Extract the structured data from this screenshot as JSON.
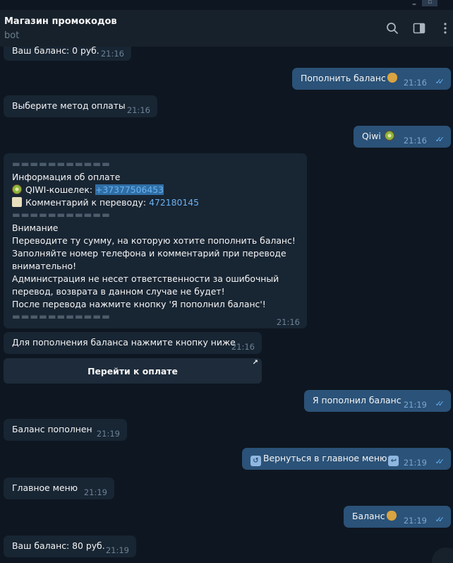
{
  "header": {
    "title": "Магазин промокодов",
    "subtitle": "bot",
    "icons": [
      "search-icon",
      "sidebar-toggle-icon",
      "more-icon"
    ]
  },
  "window": {
    "controls": [
      "minimize",
      "maximize",
      "close"
    ]
  },
  "messages": {
    "m1": {
      "text": "Ваш баланс: 0 руб.",
      "time": "21:16"
    },
    "m2": {
      "text": "Пополнить баланс",
      "time": "21:16",
      "emoji": "money-bag"
    },
    "m3": {
      "text": "Выберите метод оплаты",
      "time": "21:16"
    },
    "m4": {
      "text": "Qiwi",
      "time": "21:16",
      "emoji": "kiwi"
    },
    "m5": {
      "separator": "▬▬▬▬▬▬▬▬▬▬▬",
      "heading": "Информация об оплате",
      "wallet_label": "QIWI-кошелек:",
      "wallet_value": "+37377506453",
      "comment_label": "Комментарий к переводу:",
      "comment_value": "472180145",
      "attention": "Внимание",
      "line1": "Переводите ту сумму, на которую хотите пополнить баланс!",
      "line2": "Заполняйте номер телефона и комментарий при переводе",
      "line3": "внимательно!",
      "line4": "Администрация не несет ответственности за ошибочный",
      "line5": "перевод, возврата в данном случае не будет!",
      "line6": "После перевода нажмите кнопку 'Я пополнил баланс'!",
      "time": "21:16"
    },
    "m6": {
      "text": "Для пополнения баланса нажмите кнопку ниже",
      "time": "21:16"
    },
    "m6_button": "Перейти к оплате",
    "m7": {
      "text": "Я пополнил баланс",
      "time": "21:19"
    },
    "m8": {
      "text": "Баланс пополнен",
      "time": "21:19"
    },
    "m9": {
      "text": "Вернуться в главное меню",
      "time": "21:19"
    },
    "m10": {
      "text": "Главное меню",
      "time": "21:19"
    },
    "m11": {
      "text": "Баланс",
      "time": "21:19",
      "emoji": "money-bag"
    },
    "m12": {
      "text": "Ваш баланс: 80 руб.",
      "time": "21:19"
    }
  },
  "colors": {
    "background": "#0e1621",
    "header": "#17212b",
    "incoming": "#182533",
    "outgoing": "#2b5278",
    "link": "#6ab2f2"
  }
}
